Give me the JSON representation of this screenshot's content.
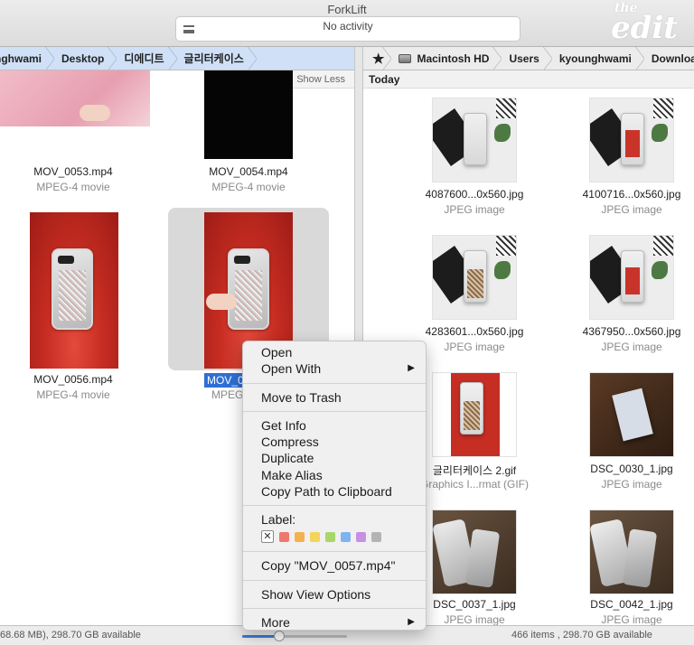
{
  "window": {
    "title": "ForkLift",
    "activity": "No activity",
    "watermark_small": "the",
    "watermark_big": "edit"
  },
  "left_pane": {
    "breadcrumbs": [
      "nghwami",
      "Desktop",
      "디에디트",
      "글리터케이스"
    ],
    "show_less": "Show Less",
    "files": [
      {
        "name": "MOV_0053.mp4",
        "kind": "MPEG-4 movie"
      },
      {
        "name": "MOV_0054.mp4",
        "kind": "MPEG-4 movie"
      },
      {
        "name": "MOV_0056.mp4",
        "kind": "MPEG-4 movie"
      },
      {
        "name": "MOV_0",
        "kind": "MPEG"
      }
    ]
  },
  "right_pane": {
    "breadcrumbs": [
      "Macintosh HD",
      "Users",
      "kyounghwami",
      "Downloads"
    ],
    "group": "Today",
    "files": [
      {
        "name": "4087600...0x560.jpg",
        "kind": "JPEG image"
      },
      {
        "name": "4100716...0x560.jpg",
        "kind": "JPEG image"
      },
      {
        "name": "4283601...0x560.jpg",
        "kind": "JPEG image"
      },
      {
        "name": "4367950...0x560.jpg",
        "kind": "JPEG image"
      },
      {
        "name": "글리터케이스 2.gif",
        "kind": "Graphics I...rmat (GIF)"
      },
      {
        "name": "DSC_0030_1.jpg",
        "kind": "JPEG image"
      },
      {
        "name": "DSC_0037_1.jpg",
        "kind": "JPEG image"
      },
      {
        "name": "DSC_0042_1.jpg",
        "kind": "JPEG image"
      }
    ]
  },
  "status": {
    "left": "68.68 MB), 298.70 GB available",
    "right": "466 items , 298.70 GB available",
    "zoom_slider_fraction": 0.35
  },
  "context_menu": {
    "items": {
      "open": "Open",
      "open_with": "Open With",
      "move_to_trash": "Move to Trash",
      "get_info": "Get Info",
      "compress": "Compress",
      "duplicate": "Duplicate",
      "make_alias": "Make Alias",
      "copy_path": "Copy Path to Clipboard",
      "label": "Label:",
      "copy_file": "Copy \"MOV_0057.mp4\"",
      "show_view_options": "Show View Options",
      "more": "More"
    },
    "submenu_arrow": "▶",
    "label_none_glyph": "✕",
    "label_colors": [
      "#f0776b",
      "#f5b04f",
      "#f2d55a",
      "#a8d66b",
      "#7fb3f0",
      "#c690e3",
      "#b4b4b4"
    ]
  }
}
